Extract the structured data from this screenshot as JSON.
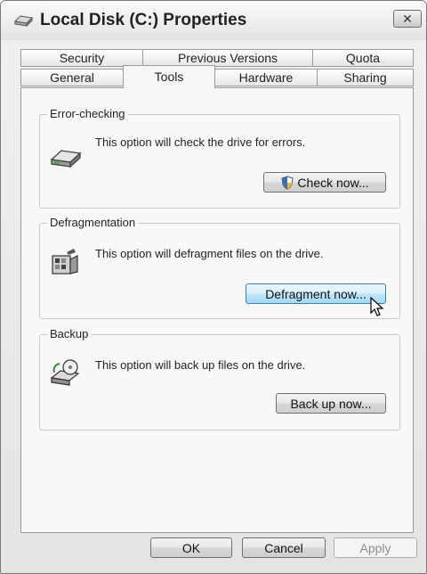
{
  "window": {
    "title": "Local Disk (C:) Properties",
    "close_glyph": "✕"
  },
  "tabs_back": [
    "Security",
    "Previous Versions",
    "Quota"
  ],
  "tabs_front": [
    "General",
    "Tools",
    "Hardware",
    "Sharing"
  ],
  "active_tab": "Tools",
  "groups": [
    {
      "label": "Error-checking",
      "text": "This option will check the drive for errors.",
      "button": "Check now...",
      "icon": "drive-icon"
    },
    {
      "label": "Defragmentation",
      "text": "This option will defragment files on the drive.",
      "button": "Defragment now...",
      "icon": "defragment-icon"
    },
    {
      "label": "Backup",
      "text": "This option will back up files on the drive.",
      "button": "Back up now...",
      "icon": "backup-icon"
    }
  ],
  "footer": {
    "ok": "OK",
    "cancel": "Cancel",
    "apply": "Apply"
  }
}
